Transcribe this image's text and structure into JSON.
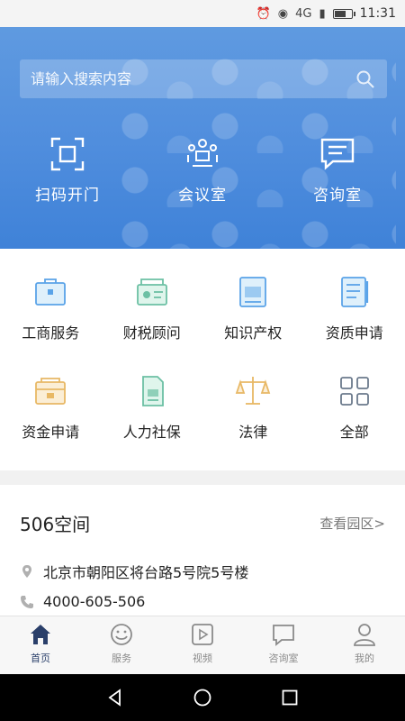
{
  "status": {
    "time": "11:31",
    "network": "4G"
  },
  "search": {
    "placeholder": "请输入搜索内容"
  },
  "quick_actions": [
    {
      "label": "扫码开门",
      "icon": "scan-icon"
    },
    {
      "label": "会议室",
      "icon": "meeting-room-icon"
    },
    {
      "label": "咨询室",
      "icon": "chat-icon"
    }
  ],
  "services": [
    {
      "label": "工商服务",
      "icon": "briefcase-icon"
    },
    {
      "label": "财税顾问",
      "icon": "finance-icon"
    },
    {
      "label": "知识产权",
      "icon": "certificate-icon"
    },
    {
      "label": "资质申请",
      "icon": "checklist-icon"
    },
    {
      "label": "资金申请",
      "icon": "money-box-icon"
    },
    {
      "label": "人力社保",
      "icon": "hr-document-icon"
    },
    {
      "label": "法律",
      "icon": "scales-icon"
    },
    {
      "label": "全部",
      "icon": "grid-icon"
    }
  ],
  "space": {
    "title": "506空间",
    "more_link": "查看园区>",
    "address": "北京市朝阳区将台路5号院5号楼",
    "phone": "4000-605-506"
  },
  "tabs": [
    {
      "label": "首页",
      "icon": "home-icon",
      "active": true
    },
    {
      "label": "服务",
      "icon": "smiley-icon",
      "active": false
    },
    {
      "label": "视频",
      "icon": "play-icon",
      "active": false
    },
    {
      "label": "咨询室",
      "icon": "message-icon",
      "active": false
    },
    {
      "label": "我的",
      "icon": "user-icon",
      "active": false
    }
  ],
  "colors": {
    "hero": "#4f8ddd",
    "icon_blue": "#5aa3e8",
    "icon_green": "#6cc0a4",
    "icon_gold": "#e8b865",
    "tab_active": "#2a3f6a"
  }
}
